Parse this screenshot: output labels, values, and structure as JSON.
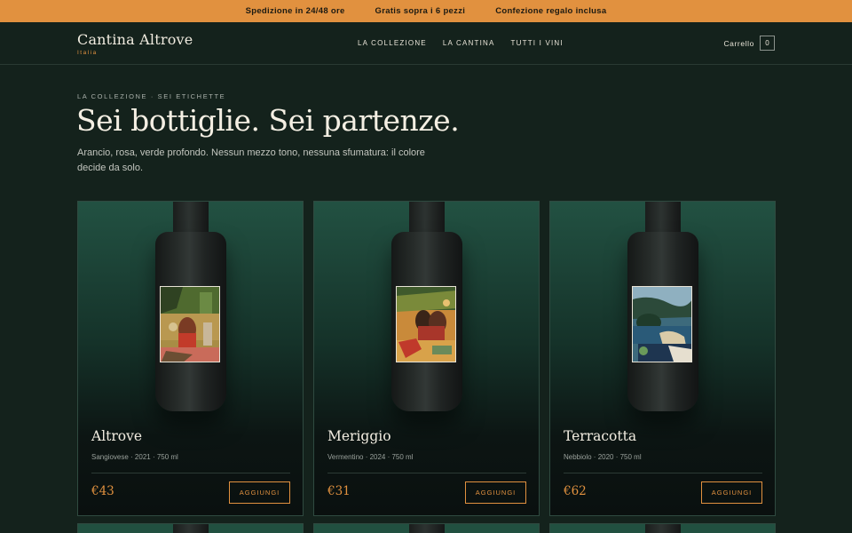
{
  "promo": {
    "items": [
      "Spedizione in 24/48 ore",
      "Gratis sopra i 6 pezzi",
      "Confezione regalo inclusa"
    ]
  },
  "header": {
    "brand": "Cantina Altrove",
    "brand_sub": "Italia",
    "nav": [
      "LA COLLEZIONE",
      "LA CANTINA",
      "TUTTI I VINI"
    ],
    "cart_label": "Carrello",
    "cart_count": "0"
  },
  "hero": {
    "eyebrow": "LA COLLEZIONE · SEI ETICHETTE",
    "title": "Sei bottiglie. Sei partenze.",
    "intro": "Arancio, rosa, verde profondo. Nessun mezzo tono, nessuna sfumatura: il colore decide da solo."
  },
  "products": [
    {
      "name": "Altrove",
      "meta": "Sangiovese · 2021 · 750 ml",
      "price": "€43",
      "button": "AGGIUNGI"
    },
    {
      "name": "Meriggio",
      "meta": "Vermentino · 2024 · 750 ml",
      "price": "€31",
      "button": "AGGIUNGI"
    },
    {
      "name": "Terracotta",
      "meta": "Nebbiolo · 2020 · 750 ml",
      "price": "€62",
      "button": "AGGIUNGI"
    }
  ],
  "colors": {
    "accent": "#e1913f",
    "background": "#14221c",
    "card_top": "#225142"
  },
  "icons": [
    "bottle-label-artwork"
  ]
}
